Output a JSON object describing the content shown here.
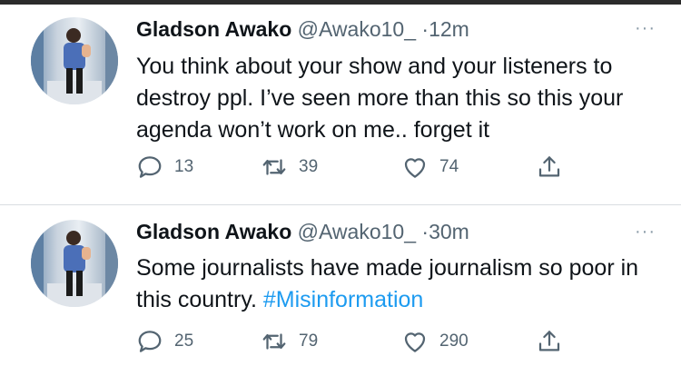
{
  "tweets": [
    {
      "name": "Gladson Awako",
      "handle": "@Awako10_",
      "separator": "·",
      "time": "12m",
      "more": "···",
      "text": "You think about your show and your listeners to destroy ppl. I’ve seen more than this so this your agenda won’t work on me.. forget it",
      "hashtag": "",
      "replies": "13",
      "retweets": "39",
      "likes": "74"
    },
    {
      "name": "Gladson Awako",
      "handle": "@Awako10_",
      "separator": "·",
      "time": "30m",
      "more": "···",
      "text": "Some journalists have made journalism so poor in this country. ",
      "hashtag": "#Misinformation",
      "replies": "25",
      "retweets": "79",
      "likes": "290"
    }
  ],
  "icons": {
    "reply": "reply-icon",
    "retweet": "retweet-icon",
    "like": "heart-icon",
    "share": "share-icon",
    "more": "more-icon"
  },
  "colors": {
    "text": "#0f1419",
    "secondary": "#536471",
    "link": "#1d9bf0",
    "divider": "#d9dde1"
  }
}
